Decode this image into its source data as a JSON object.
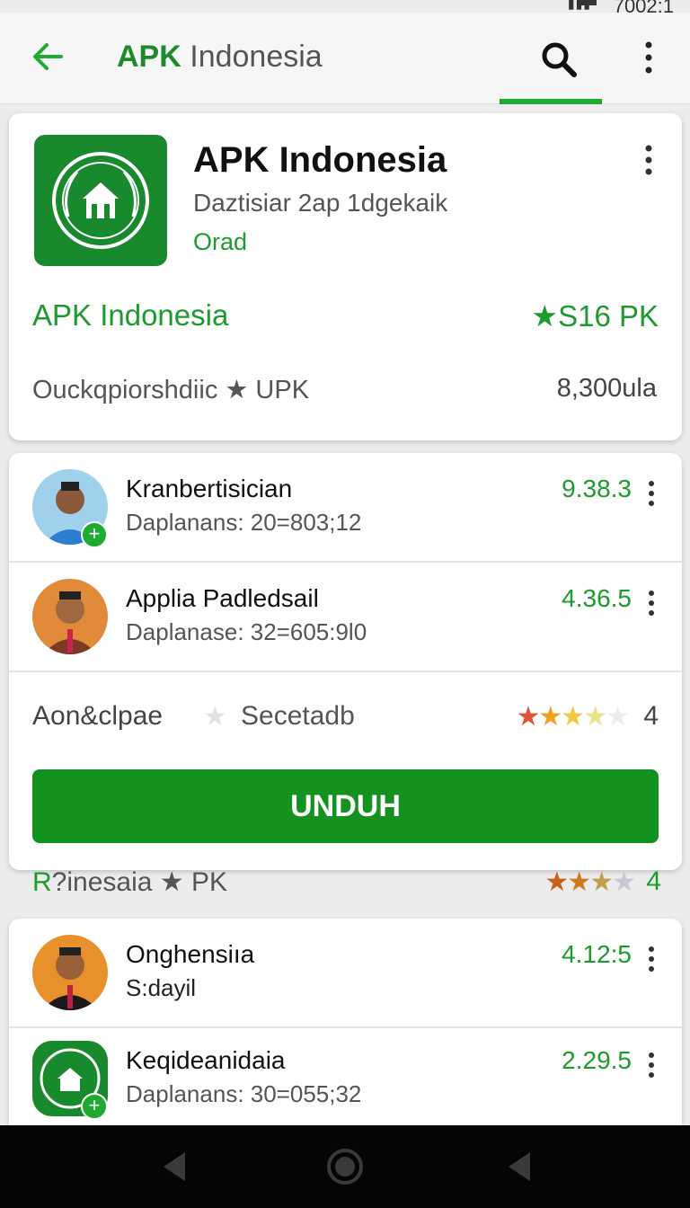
{
  "status": {
    "time": "7002:1"
  },
  "appbar": {
    "title_bold": "APK",
    "title_rest": "Indonesia"
  },
  "card1": {
    "title": "APK Indonesia",
    "subtitle": "Daztisiar 2ap 1dgekaik",
    "tag": "Orad",
    "name": "APK Indonesia",
    "rating": "★S16 PK",
    "category": "Ouckqpiorshdiic ★ UPK",
    "downloads": "8,300ula"
  },
  "card2": {
    "rows": [
      {
        "name": "Kranbertisician",
        "sub": "Daplanans: 20=803;12",
        "score": "9.38.3"
      },
      {
        "name": "Applia Padledsail",
        "sub": "Daplanase: 32=605:9l0",
        "score": "4.36.5"
      }
    ],
    "summary": {
      "category": "Aon&clpae",
      "star": "★",
      "section": "Secetadb",
      "stars": "★★★★★",
      "rating": "4"
    },
    "button": "UNDUH"
  },
  "mid": {
    "prefix": "R",
    "text": "?inesaia ★ PK",
    "stars": "★★★★",
    "rating": "4"
  },
  "card3": {
    "rows": [
      {
        "name": "Onghensiıa",
        "sub": "S:dayil",
        "score": "4.12:5"
      },
      {
        "name": "Keqideanidaia",
        "sub": "Daplanans: 30=055;32",
        "score": "2.29.5"
      }
    ]
  },
  "colors": {
    "brand_green": "#1f9a2e",
    "button_green": "#13921f",
    "icon_green": "#18892c"
  },
  "icons": [
    "back-arrow-icon",
    "search-icon",
    "more-vert-icon",
    "app-emblem-icon",
    "star-icon",
    "nav-back-icon",
    "nav-home-icon",
    "nav-recents-icon"
  ]
}
